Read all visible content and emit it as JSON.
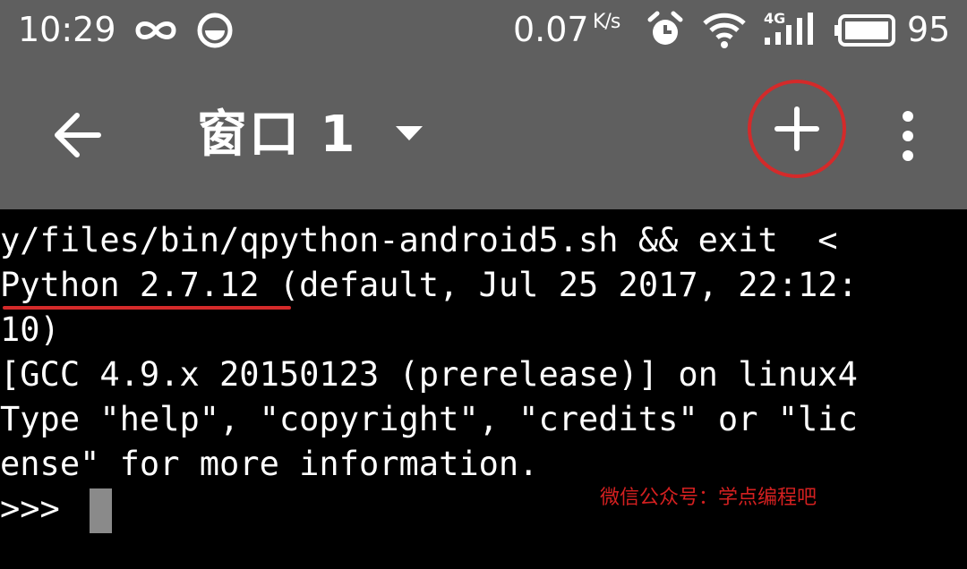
{
  "status_bar": {
    "time": "10:29",
    "left_icons": [
      "infinity-icon",
      "mood-icon"
    ],
    "net_speed": "0.07",
    "net_speed_unit": "K/s",
    "right_icons": [
      "alarm-icon",
      "wifi-icon",
      "signal-4g-icon",
      "battery-icon"
    ],
    "signal_label": "4G",
    "battery_percent": "95"
  },
  "toolbar": {
    "title": "窗口 1",
    "back_icon": "arrow-left-icon",
    "dropdown_icon": "caret-down-icon",
    "add_icon": "plus-icon",
    "more_icon": "more-vertical-icon",
    "add_highlight_color": "#d42a2a"
  },
  "terminal": {
    "lines": [
      "y/files/bin/qpython-android5.sh && exit  <",
      "Python 2.7.12 (default, Jul 25 2017, 22:12:",
      "10)",
      "[GCC 4.9.x 20150123 (prerelease)] on linux4",
      "Type \"help\", \"copyright\", \"credits\" or \"lic",
      "ense\" for more information.",
      ">>> "
    ],
    "underline_color": "#d42a2a",
    "watermark": "微信公众号：学点编程吧"
  }
}
